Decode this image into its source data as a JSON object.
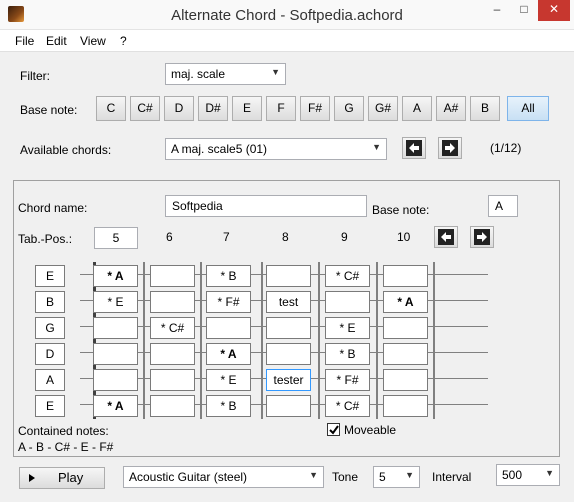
{
  "window": {
    "title": "Alternate Chord - Softpedia.achord",
    "minimize": "–",
    "maximize": "□",
    "close": "✕"
  },
  "menu": [
    "File",
    "Edit",
    "View",
    "?"
  ],
  "filter": {
    "label": "Filter:",
    "value": "maj. scale"
  },
  "base_note_row": {
    "label": "Base note:",
    "notes": [
      "C",
      "C#",
      "D",
      "D#",
      "E",
      "F",
      "F#",
      "G",
      "G#",
      "A",
      "A#",
      "B"
    ],
    "all_label": "All"
  },
  "available": {
    "label": "Available chords:",
    "value": "A maj. scale5 (01)",
    "counter": "(1/12)"
  },
  "chord": {
    "name_label": "Chord name:",
    "name_value": "Softpedia",
    "base_label": "Base note:",
    "base_value": "A",
    "tab_pos_label": "Tab.-Pos.:",
    "tab_pos_value": "5",
    "fret_numbers": [
      "6",
      "7",
      "8",
      "9",
      "10"
    ]
  },
  "fretboard": {
    "strings": [
      "E",
      "B",
      "G",
      "D",
      "A",
      "E"
    ],
    "cells": [
      [
        "* A",
        "",
        "* B",
        "",
        "* C#",
        ""
      ],
      [
        "* E",
        "",
        "* F#",
        "test",
        "",
        "* A"
      ],
      [
        "",
        "* C#",
        "",
        "",
        "* E",
        ""
      ],
      [
        "",
        "",
        "* A",
        "",
        "* B",
        ""
      ],
      [
        "",
        "",
        "* E",
        "tester",
        "* F#",
        ""
      ],
      [
        "* A",
        "",
        "* B",
        "",
        "* C#",
        ""
      ]
    ]
  },
  "contained": {
    "label": "Contained notes:",
    "value": "A - B - C# - E - F#"
  },
  "moveable": {
    "label": "Moveable",
    "checked": true
  },
  "bottom": {
    "play_label": "Play",
    "instrument": "Acoustic Guitar (steel)",
    "tone_label": "Tone",
    "tone_value": "5",
    "interval_label": "Interval",
    "interval_value": "500"
  },
  "icons": {
    "app": "app-guitar-icon",
    "left": "left-arrow-icon",
    "right": "right-arrow-icon",
    "dropdown": "chevron-down-icon"
  }
}
